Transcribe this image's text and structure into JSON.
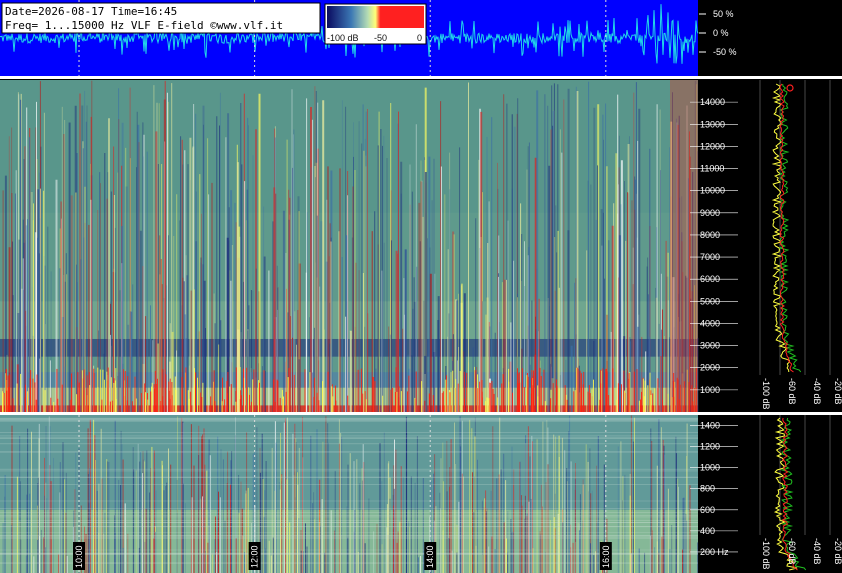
{
  "header": {
    "line1": "Date=2026-08-17 Time=16:45",
    "line2": "Freq= 1...15000 Hz   VLF E-field ©www.vlf.it"
  },
  "colorbar": {
    "labels": [
      "-100 dB",
      "-50",
      "0"
    ],
    "colors": [
      "#0a0a60",
      "#3c78b4",
      "#b4dcb4",
      "#ffff78",
      "#ff2020"
    ]
  },
  "chart_data": [
    {
      "type": "line",
      "name": "waveform-amplitude",
      "ylabel": "",
      "yticks": [
        "50 %",
        "0 %",
        "-50 %"
      ],
      "ylim": [
        -100,
        100
      ],
      "background": "#0000ff",
      "trace_color": "#20d8e8"
    },
    {
      "type": "heatmap",
      "name": "spectrogram-full",
      "xticks": [
        "10:00",
        "12:00",
        "14:00",
        "16:00"
      ],
      "yticks": [
        "1000",
        "2000",
        "3000",
        "4000",
        "5000",
        "6000",
        "7000",
        "8000",
        "9000",
        "10000",
        "11000",
        "12000",
        "13000",
        "14000"
      ],
      "ylim": [
        0,
        15000
      ],
      "colorscale_db": [
        -100,
        0
      ]
    },
    {
      "type": "heatmap",
      "name": "spectrogram-low",
      "xticks": [
        "10:00",
        "12:00",
        "14:00",
        "16:00"
      ],
      "yticks": [
        "200 Hz",
        "400",
        "600",
        "800",
        "1000",
        "1200",
        "1400"
      ],
      "ylim": [
        0,
        1500
      ],
      "colorscale_db": [
        -100,
        0
      ]
    },
    {
      "type": "line",
      "name": "spectrum-full",
      "xticks": [
        "-100 dB",
        "-60 dB",
        "-40 dB",
        "-20 dB"
      ],
      "series_colors": [
        "#ffff40",
        "#20c020",
        "#ff2020"
      ]
    },
    {
      "type": "line",
      "name": "spectrum-low",
      "xticks": [
        "-100 dB",
        "-60 dB",
        "-40 dB",
        "-20 dB"
      ],
      "series_colors": [
        "#ffff40",
        "#20c020",
        "#ff2020"
      ]
    }
  ]
}
